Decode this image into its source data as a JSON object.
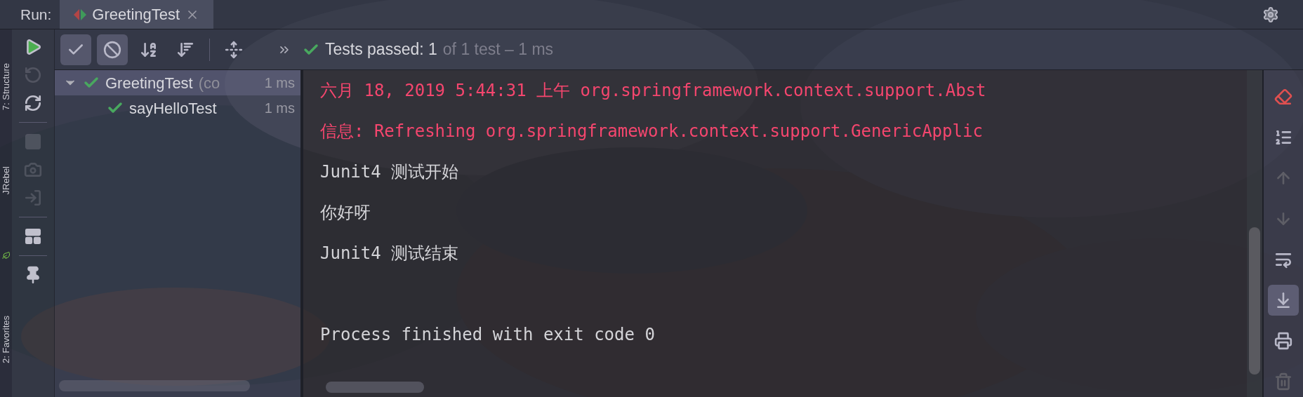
{
  "run_label": "Run:",
  "tabs": [
    {
      "label": "GreetingTest",
      "selected": true
    }
  ],
  "stripe_labels": [
    "7: Structure",
    "JRebel",
    "2: Favorites"
  ],
  "side_toolbar": [
    {
      "disabled": false
    },
    {
      "disabled": true
    },
    {
      "disabled": false
    },
    {
      "disabled": true
    },
    {
      "disabled": true
    },
    {
      "disabled": true
    },
    {
      "disabled": false
    },
    {
      "disabled": false
    }
  ],
  "top_toolbar": [
    {
      "selected": true
    },
    {
      "selected": true
    },
    {
      "selected": false
    },
    {
      "selected": false
    },
    {
      "selected": false
    }
  ],
  "status": {
    "passed": "Tests passed: 1",
    "detail": "of 1 test – 1 ms"
  },
  "tree": [
    {
      "name": "GreetingTest",
      "note": "(co",
      "time": "1 ms",
      "selected": true,
      "expanded": true,
      "children": [
        {
          "name": "sayHelloTest",
          "time": "1 ms",
          "selected": false
        }
      ]
    }
  ],
  "console": [
    {
      "kind": "error",
      "text": "六月 18, 2019 5:44:31 上午 org.springframework.context.support.Abst"
    },
    {
      "kind": "error",
      "text": "信息: Refreshing org.springframework.context.support.GenericApplic"
    },
    {
      "kind": "normal",
      "text": "Junit4 测试开始"
    },
    {
      "kind": "normal",
      "text": "你好呀"
    },
    {
      "kind": "normal",
      "text": "Junit4 测试结束"
    },
    {
      "kind": "blank"
    },
    {
      "kind": "normal",
      "text": "Process finished with exit code 0"
    }
  ],
  "right_toolbar": [
    {
      "disabled": false,
      "selected": false
    },
    {
      "disabled": false,
      "selected": false
    },
    {
      "disabled": true,
      "selected": false
    },
    {
      "disabled": true,
      "selected": false
    },
    {
      "disabled": false,
      "selected": false
    },
    {
      "disabled": false,
      "selected": true
    },
    {
      "disabled": false,
      "selected": false
    },
    {
      "disabled": true,
      "selected": false
    }
  ]
}
